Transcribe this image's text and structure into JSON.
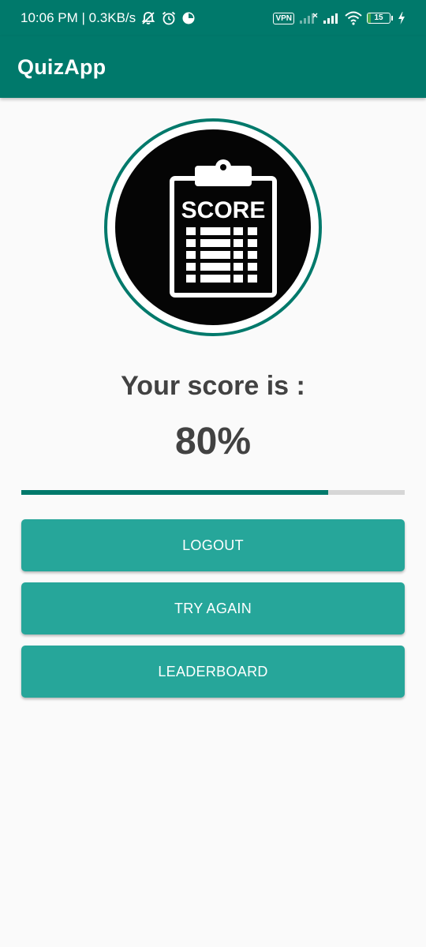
{
  "status_bar": {
    "time_network": "10:06 PM | 0.3KB/s",
    "vpn_label": "VPN",
    "battery_level": "15",
    "battery_fraction": 0.15,
    "icons": [
      "mute-notification-icon",
      "alarm-icon",
      "data-saver-icon",
      "signal-icon",
      "signal-icon",
      "wifi-icon",
      "battery-icon",
      "charging-icon"
    ]
  },
  "app_bar": {
    "title": "QuizApp"
  },
  "result": {
    "image_label": "SCORE",
    "heading": "Your score is :",
    "score": "80%",
    "progress_fraction": 0.8
  },
  "buttons": {
    "logout": "LOGOUT",
    "try_again": "TRY AGAIN",
    "leaderboard": "LEADERBOARD"
  },
  "colors": {
    "primary": "#00796b",
    "button": "#26a69a",
    "background": "#fafafa",
    "text": "#424242",
    "track": "#d6d6d6"
  }
}
